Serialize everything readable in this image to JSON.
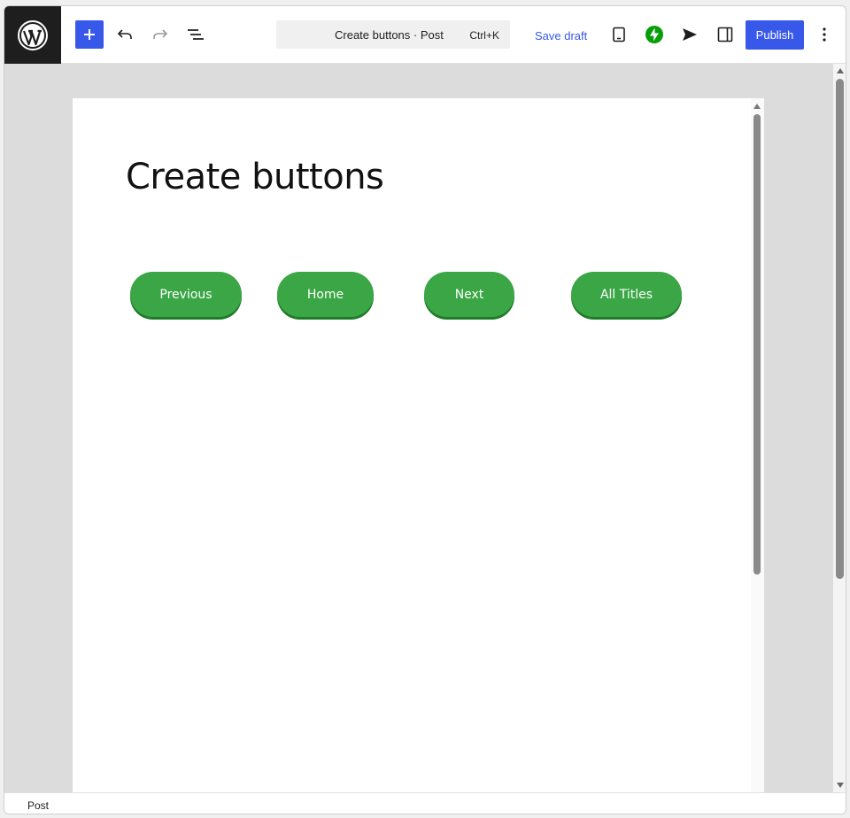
{
  "toolbar": {
    "wp_logo_icon": "wordpress-icon",
    "add_icon": "plus-icon",
    "undo_icon": "undo-icon",
    "redo_icon": "redo-icon",
    "list_view_icon": "list-view-icon",
    "command_title": "Create buttons · Post",
    "command_shortcut": "Ctrl+K",
    "save_draft_label": "Save draft",
    "preview_icon": "tablet-icon",
    "jetpack_icon": "jetpack-bolt-icon",
    "send_icon": "send-icon",
    "settings_icon": "sidebar-toggle-icon",
    "publish_label": "Publish",
    "options_icon": "more-vertical-icon"
  },
  "editor": {
    "post_title": "Create buttons",
    "buttons": [
      {
        "label": "Previous"
      },
      {
        "label": "Home"
      },
      {
        "label": "Next"
      },
      {
        "label": "All Titles"
      }
    ]
  },
  "footer": {
    "breadcrumb": "Post"
  },
  "colors": {
    "accent": "#3858e9",
    "button_green": "#3aa645",
    "button_shadow": "#1f7a2a",
    "jetpack_green": "#069e08"
  }
}
